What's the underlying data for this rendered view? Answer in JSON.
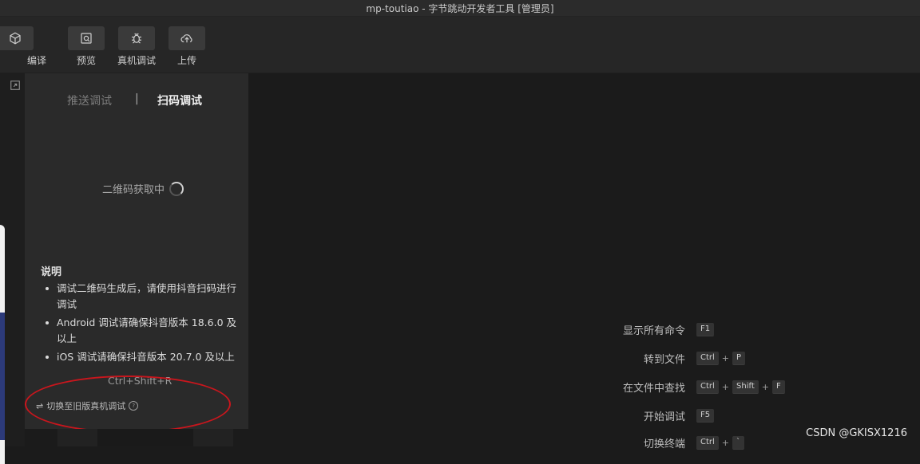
{
  "window": {
    "title": "mp-toutiao - 字节跳动开发者工具 [管理员]"
  },
  "toolbar": {
    "compile_label": "编译",
    "preview_label": "预览",
    "device_debug_label": "真机调试",
    "upload_label": "上传"
  },
  "panel": {
    "tab_push": "推送调试",
    "tab_separator": "|",
    "tab_scan": "扫码调试",
    "qr_status": "二维码获取中",
    "notes_title": "说明",
    "notes": [
      "调试二维码生成后，请使用抖音扫码进行调试",
      "Android 调试请确保抖音版本 18.6.0 及以上",
      "iOS 调试请确保抖音版本 20.7.0 及以上"
    ],
    "shortcut_hint": "Ctrl+Shift+R",
    "switch_legacy": "切换至旧版真机调试",
    "switch_icon": "⇌",
    "help_icon": "?"
  },
  "shortcuts": [
    {
      "label": "显示所有命令",
      "keys": [
        "F1"
      ]
    },
    {
      "label": "转到文件",
      "keys": [
        "Ctrl",
        "P"
      ]
    },
    {
      "label": "在文件中查找",
      "keys": [
        "Ctrl",
        "Shift",
        "F"
      ]
    },
    {
      "label": "开始调试",
      "keys": [
        "F5"
      ]
    },
    {
      "label": "切换终端",
      "keys": [
        "Ctrl",
        "`"
      ]
    }
  ],
  "shortcut_plus": "+",
  "watermark": "CSDN @GKISX1216",
  "icons": {
    "compile": "cube-icon",
    "preview": "search-doc-icon",
    "device_debug": "bug-icon",
    "upload": "cloud-upload-icon"
  },
  "colors": {
    "annotation": "#c8161d",
    "panel": "#2a2a2a",
    "background": "#1b1b1b"
  }
}
